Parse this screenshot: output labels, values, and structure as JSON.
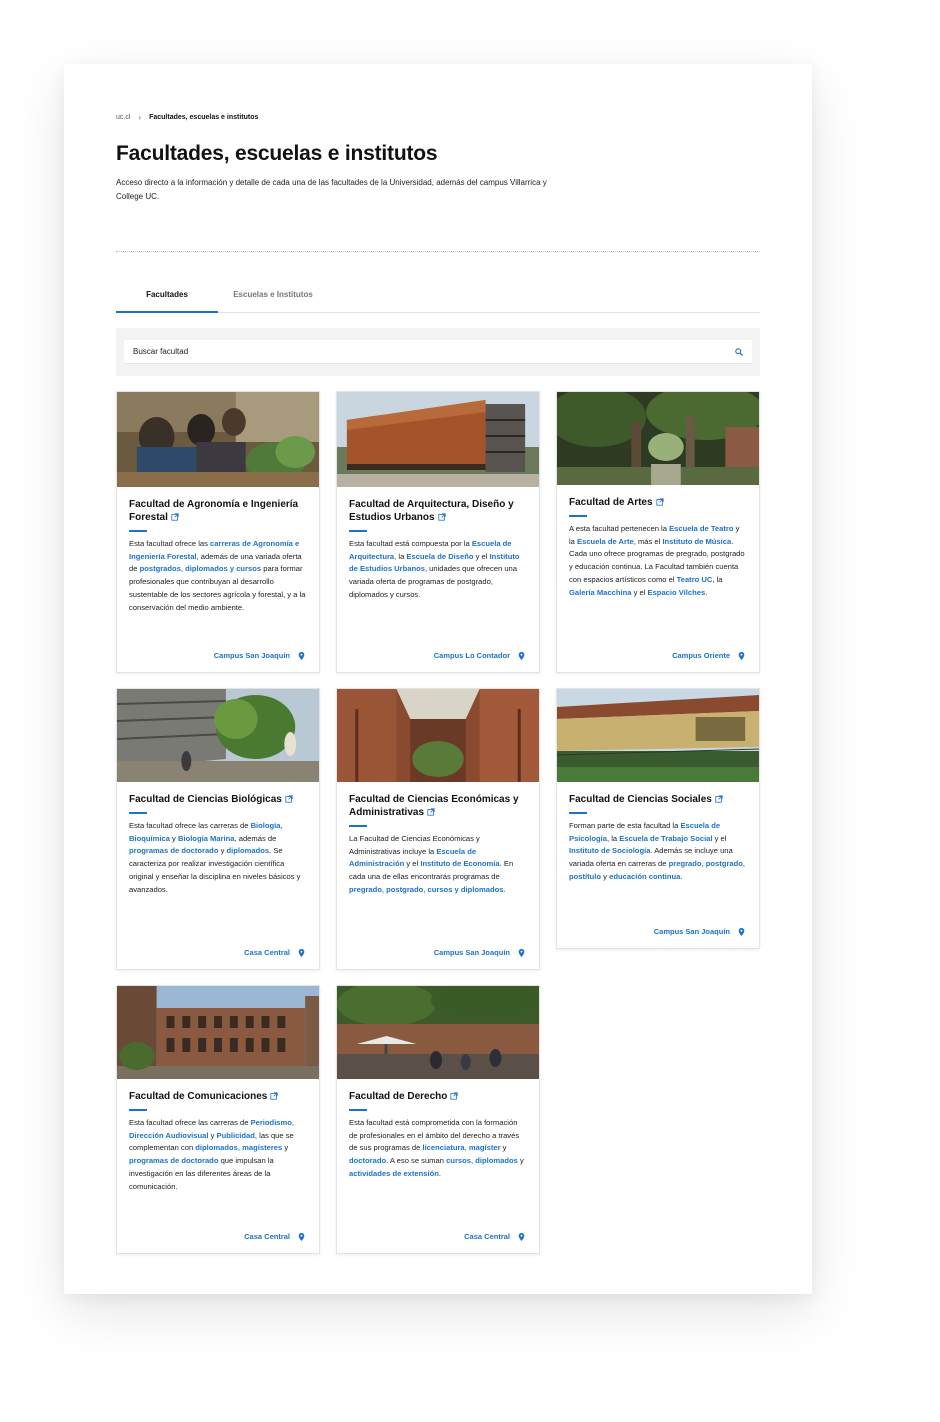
{
  "breadcrumb": {
    "home": "uc.cl",
    "current": "Facultades, escuelas e institutos"
  },
  "page_title": "Facultades, escuelas e institutos",
  "intro": "Acceso directo a la información y detalle de cada una de las facultades de la Universidad, además del campus Villarrica y College UC.",
  "tabs": [
    {
      "label": "Facultades"
    },
    {
      "label": "Escuelas e Institutos"
    }
  ],
  "search": {
    "placeholder": "Buscar facultad"
  },
  "colors": {
    "accent": "#1d72c7"
  },
  "icons": {
    "search": "search-icon",
    "external": "external-link-icon",
    "location": "map-pin-icon"
  },
  "cards": [
    {
      "title": "Facultad de Agronomía e Ingeniería Forestal",
      "desc": [
        {
          "t": "Esta facultad ofrece las "
        },
        {
          "t": "carreras de Agronomía e Ingeniería Forestal",
          "link": true
        },
        {
          "t": ", además de una variada oferta de "
        },
        {
          "t": "postgrados",
          "link": true
        },
        {
          "t": ", "
        },
        {
          "t": "diplomados y cursos",
          "link": true
        },
        {
          "t": " para formar profesionales que contribuyan al desarrollo sustentable de los sectores agrícola y forestal, y a la conservación del medio ambiente."
        }
      ],
      "campus": "Campus San Joaquín"
    },
    {
      "title": "Facultad de Arquitectura, Diseño y Estudios Urbanos",
      "desc": [
        {
          "t": "Esta facultad está compuesta por la "
        },
        {
          "t": "Escuela de Arquitectura",
          "link": true
        },
        {
          "t": ", la "
        },
        {
          "t": "Escuela de Diseño",
          "link": true
        },
        {
          "t": " y el "
        },
        {
          "t": "Instituto de Estudios Urbanos",
          "link": true
        },
        {
          "t": ", unidades que ofrecen una variada oferta de programas de postgrado, diplomados y cursos."
        }
      ],
      "campus": "Campus Lo Contador"
    },
    {
      "title": "Facultad de Artes",
      "desc": [
        {
          "t": "A esta facultad pertenecen la "
        },
        {
          "t": "Escuela de Teatro",
          "link": true
        },
        {
          "t": " y la "
        },
        {
          "t": "Escuela de Arte",
          "link": true
        },
        {
          "t": ", más el "
        },
        {
          "t": "Instituto de Música",
          "link": true
        },
        {
          "t": ". Cada uno ofrece programas de pregrado, postgrado y educación continua. La Facultad también cuenta con espacios artísticos como el "
        },
        {
          "t": "Teatro UC",
          "link": true
        },
        {
          "t": ", la "
        },
        {
          "t": "Galería Macchina",
          "link": true
        },
        {
          "t": " y el "
        },
        {
          "t": "Espacio Vilches",
          "link": true
        },
        {
          "t": "."
        }
      ],
      "campus": "Campus Oriente"
    },
    {
      "title": "Facultad de Ciencias Biológicas",
      "desc": [
        {
          "t": "Esta facultad ofrece las carreras de "
        },
        {
          "t": "Biología",
          "link": true
        },
        {
          "t": ", "
        },
        {
          "t": "Bioquímica",
          "link": true
        },
        {
          "t": " y "
        },
        {
          "t": "Biología Marina",
          "link": true
        },
        {
          "t": ", además de "
        },
        {
          "t": "programas de doctorado",
          "link": true
        },
        {
          "t": " y "
        },
        {
          "t": "diplomados",
          "link": true
        },
        {
          "t": ". Se caracteriza por realizar investigación científica original y enseñar la disciplina en niveles básicos y avanzados."
        }
      ],
      "campus": "Casa Central"
    },
    {
      "title": "Facultad de Ciencias Económicas y Administrativas",
      "desc": [
        {
          "t": "La Facultad de Ciencias Económicas y Administrativas incluye la "
        },
        {
          "t": "Escuela de Administración",
          "link": true
        },
        {
          "t": " y el "
        },
        {
          "t": "Instituto de Economía",
          "link": true
        },
        {
          "t": ". En cada una de ellas encontrarás programas de "
        },
        {
          "t": "pregrado",
          "link": true
        },
        {
          "t": ", "
        },
        {
          "t": "postgrado",
          "link": true
        },
        {
          "t": ", "
        },
        {
          "t": "cursos y diplomados",
          "link": true
        },
        {
          "t": "."
        }
      ],
      "campus": "Campus San Joaquín"
    },
    {
      "title": "Facultad de Ciencias Sociales",
      "desc": [
        {
          "t": "Forman parte de esta facultad la "
        },
        {
          "t": "Escuela de Psicología",
          "link": true
        },
        {
          "t": ", la "
        },
        {
          "t": "Escuela de Trabajo Social",
          "link": true
        },
        {
          "t": " y el "
        },
        {
          "t": "Instituto de Sociología",
          "link": true
        },
        {
          "t": ". Además se incluye una variada oferta en carreras de "
        },
        {
          "t": "pregrado",
          "link": true
        },
        {
          "t": ", "
        },
        {
          "t": "postgrado",
          "link": true
        },
        {
          "t": ", "
        },
        {
          "t": "postítulo",
          "link": true
        },
        {
          "t": " y "
        },
        {
          "t": "educación continua",
          "link": true
        },
        {
          "t": "."
        }
      ],
      "campus": "Campus San Joaquín"
    },
    {
      "title": "Facultad de Comunicaciones",
      "desc": [
        {
          "t": "Esta facultad ofrece las carreras de "
        },
        {
          "t": "Periodismo",
          "link": true
        },
        {
          "t": ", "
        },
        {
          "t": "Dirección Audiovisual",
          "link": true
        },
        {
          "t": " y "
        },
        {
          "t": "Publicidad",
          "link": true
        },
        {
          "t": ", las que se complementan con "
        },
        {
          "t": "diplomados",
          "link": true
        },
        {
          "t": ", "
        },
        {
          "t": "magísteres",
          "link": true
        },
        {
          "t": " y "
        },
        {
          "t": "programas de doctorado",
          "link": true
        },
        {
          "t": " que impulsan la investigación en las diferentes áreas de la comunicación."
        }
      ],
      "campus": "Casa Central"
    },
    {
      "title": "Facultad de Derecho",
      "desc": [
        {
          "t": "Esta facultad está comprometida con la formación de profesionales en el ámbito del derecho a través de sus programas de "
        },
        {
          "t": "licenciatura",
          "link": true
        },
        {
          "t": ", "
        },
        {
          "t": "magíster",
          "link": true
        },
        {
          "t": " y "
        },
        {
          "t": "doctorado",
          "link": true
        },
        {
          "t": ". A eso se suman "
        },
        {
          "t": "cursos",
          "link": true
        },
        {
          "t": ", "
        },
        {
          "t": "diplomados",
          "link": true
        },
        {
          "t": " y "
        },
        {
          "t": "actividades de extensión",
          "link": true
        },
        {
          "t": "."
        }
      ],
      "campus": "Casa Central"
    }
  ]
}
